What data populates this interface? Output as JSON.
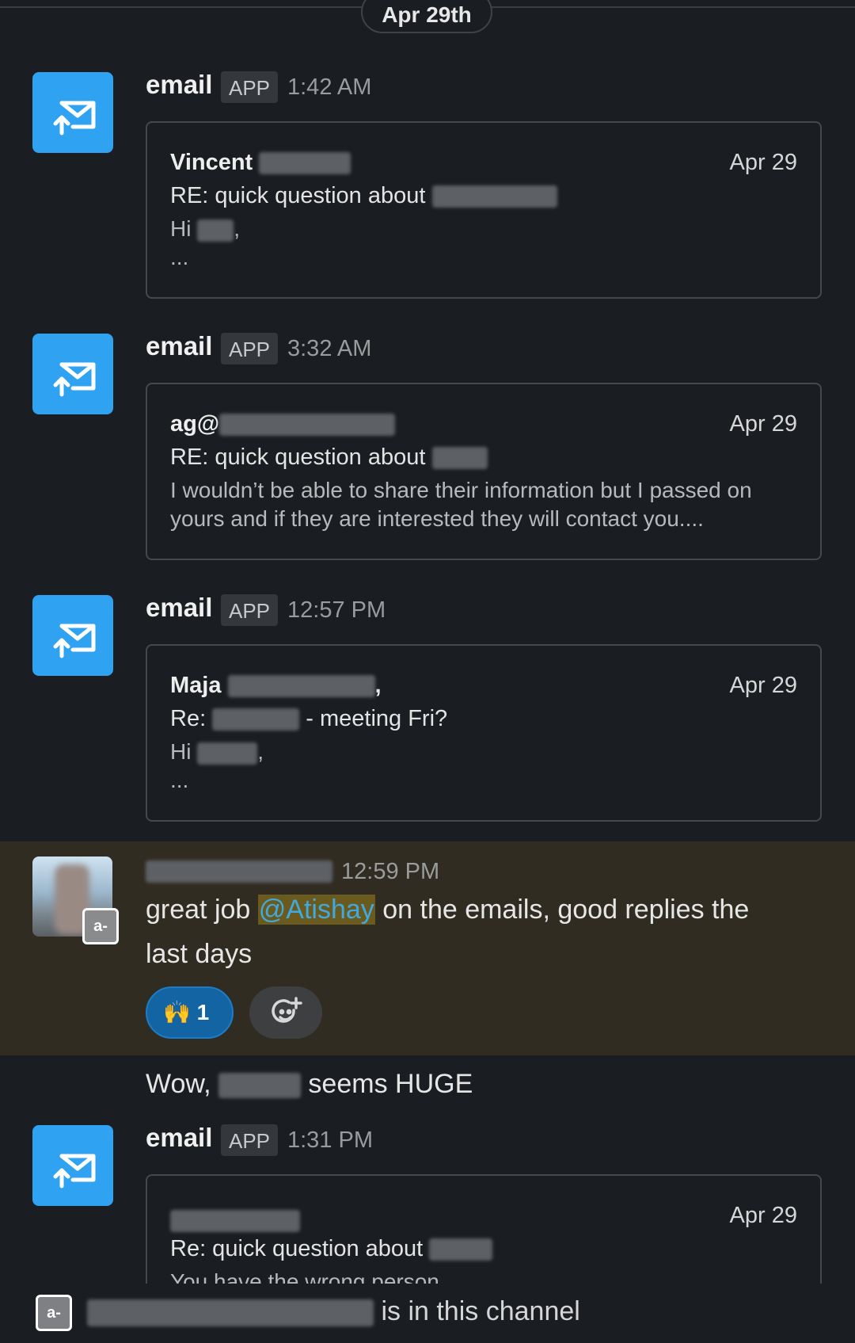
{
  "date_divider": "Apr 29th",
  "messages": [
    {
      "sender": "email",
      "badge": "APP",
      "time": "1:42 AM",
      "card": {
        "from": "Vincent",
        "date": "Apr 29",
        "subject": "RE: quick question about",
        "body_prefix": "Hi",
        "body_suffix": ",",
        "ellipsis": "..."
      }
    },
    {
      "sender": "email",
      "badge": "APP",
      "time": "3:32 AM",
      "card": {
        "from": "ag@",
        "date": "Apr 29",
        "subject": "RE: quick question about",
        "body": "I wouldn’t be able to share their information but I passed on yours and if they are interested they will contact you...."
      }
    },
    {
      "sender": "email",
      "badge": "APP",
      "time": "12:57 PM",
      "card": {
        "from": "Maja",
        "from_suffix": ",",
        "date": "Apr 29",
        "subject_prefix": "Re:",
        "subject_suffix": "- meeting Fri?",
        "body_prefix": "Hi",
        "body_suffix": ",",
        "ellipsis": "..."
      }
    },
    {
      "time": "12:59 PM",
      "badge": "a-",
      "text_before": "great job ",
      "mention": "@Atishay",
      "text_after": " on the emails, good replies the last days",
      "reaction": {
        "emoji": "🙌",
        "count": "1"
      }
    },
    {
      "text_prefix": "Wow,",
      "text_suffix": "seems HUGE"
    },
    {
      "sender": "email",
      "badge": "APP",
      "time": "1:31 PM",
      "card": {
        "date": "Apr 29",
        "subject": "Re: quick question about",
        "body": "You have the wrong person"
      }
    }
  ],
  "bottom_bar": {
    "badge": "a-",
    "text": "is in this channel"
  },
  "icons": {
    "app_avatar": "email-upload-icon",
    "add_reaction": "add-reaction-icon"
  },
  "colors": {
    "background": "#1a1d21",
    "app_avatar": "#2fa3f2",
    "highlight_row": "#302c22",
    "mention_bg": "#6a5a1e",
    "mention_text": "#3fa9e0",
    "reaction_bg": "#1264a3"
  }
}
